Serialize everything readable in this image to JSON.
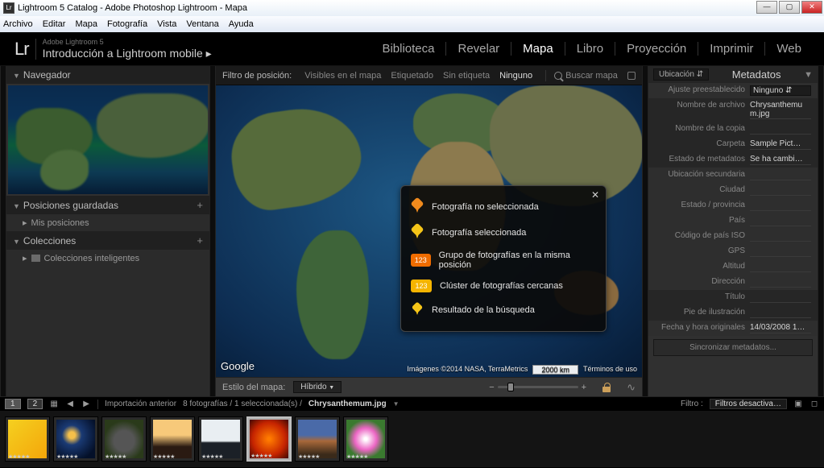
{
  "window": {
    "title": "Lightroom 5 Catalog - Adobe Photoshop Lightroom - Mapa"
  },
  "menubar": [
    "Archivo",
    "Editar",
    "Mapa",
    "Fotografía",
    "Vista",
    "Ventana",
    "Ayuda"
  ],
  "identity": {
    "small": "Adobe Lightroom 5",
    "big": "Introducción a Lightroom mobile  ▸",
    "logo": "Lr"
  },
  "modules": [
    "Biblioteca",
    "Revelar",
    "Mapa",
    "Libro",
    "Proyección",
    "Imprimir",
    "Web"
  ],
  "active_module": "Mapa",
  "left": {
    "navigator": "Navegador",
    "saved_loc": "Posiciones guardadas",
    "my_loc": "Mis posiciones",
    "collections": "Colecciones",
    "smart": "Colecciones inteligentes"
  },
  "filterbar": {
    "label": "Filtro de posición:",
    "items": [
      "Visibles en el mapa",
      "Etiquetado",
      "Sin etiqueta",
      "Ninguno"
    ],
    "active": "Ninguno",
    "search": "Buscar mapa"
  },
  "legend": {
    "r1": "Fotografía no seleccionada",
    "r2": "Fotografía seleccionada",
    "r3": "Grupo de fotografías en la misma posición",
    "r4": "Clúster de fotografías cercanas",
    "r5": "Resultado de la búsqueda",
    "badge": "123"
  },
  "map": {
    "google": "Google",
    "attr": "Imágenes ©2014 NASA, TerraMetrics",
    "scale": "2000 km",
    "terms": "Términos de uso"
  },
  "stylebar": {
    "label": "Estilo del mapa:",
    "value": "Híbrido"
  },
  "right": {
    "scope": "Ubicación",
    "title": "Metadatos",
    "preset_lbl": "Ajuste preestablecido",
    "preset_val": "Ninguno",
    "rows1": [
      {
        "lbl": "Nombre de archivo",
        "val": "Chrysanthemum.jpg"
      },
      {
        "lbl": "Nombre de la copia",
        "val": ""
      },
      {
        "lbl": "Carpeta",
        "val": "Sample Pict…"
      },
      {
        "lbl": "Estado de metadatos",
        "val": "Se ha cambi…"
      }
    ],
    "rows2": [
      {
        "lbl": "Ubicación secundaria",
        "val": ""
      },
      {
        "lbl": "Ciudad",
        "val": ""
      },
      {
        "lbl": "Estado / provincia",
        "val": ""
      },
      {
        "lbl": "País",
        "val": ""
      },
      {
        "lbl": "Código de país ISO",
        "val": ""
      },
      {
        "lbl": "GPS",
        "val": ""
      },
      {
        "lbl": "Altitud",
        "val": ""
      },
      {
        "lbl": "Dirección",
        "val": ""
      }
    ],
    "rows3": [
      {
        "lbl": "Título",
        "val": ""
      },
      {
        "lbl": "Pie de ilustración",
        "val": ""
      }
    ],
    "rows4": [
      {
        "lbl": "Fecha y hora originales",
        "val": "14/03/2008 1…"
      }
    ],
    "sync": "Sincronizar metadatos..."
  },
  "strip": {
    "badges": [
      "1",
      "2"
    ],
    "import": "Importación anterior",
    "count": "8 fotografías / 1 seleccionada(s) /",
    "file": "Chrysanthemum.jpg",
    "filter_lbl": "Filtro :",
    "filter_val": "Filtros desactiva…",
    "stars": "★★★★★"
  }
}
